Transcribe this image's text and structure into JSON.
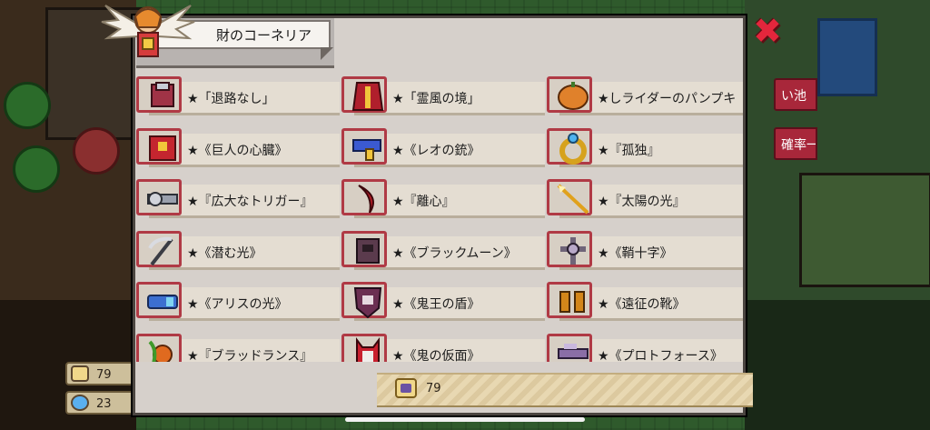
{
  "header": {
    "title": "財のコーネリア"
  },
  "items": [
    {
      "label": "★「退路なし」",
      "icon": "armor-icon",
      "color": "#a03346"
    },
    {
      "label": "★「霊風の境」",
      "icon": "robe-icon",
      "color": "#b01f2c"
    },
    {
      "label": "★しライダーのパンプキ",
      "icon": "pumpkin-icon",
      "color": "#e0812b"
    },
    {
      "label": "★《巨人の心臓》",
      "icon": "heart-armor-icon",
      "color": "#c4252f"
    },
    {
      "label": "★《レオの銃》",
      "icon": "gun-icon",
      "color": "#3b5ad1"
    },
    {
      "label": "★『孤独』",
      "icon": "ring-icon",
      "color": "#d6a21d"
    },
    {
      "label": "★『広大なトリガー』",
      "icon": "cannon-icon",
      "color": "#9aa0ad"
    },
    {
      "label": "★『離心』",
      "icon": "blade-icon",
      "color": "#b51c25"
    },
    {
      "label": "★『太陽の光』",
      "icon": "spear-icon",
      "color": "#e0a11c"
    },
    {
      "label": "★《潜む光》",
      "icon": "scythe-icon",
      "color": "#5c5f6b"
    },
    {
      "label": "★《ブラックムーン》",
      "icon": "dark-block-icon",
      "color": "#5b3b4d"
    },
    {
      "label": "★《鞘十字》",
      "icon": "cross-icon",
      "color": "#6f6478"
    },
    {
      "label": "★《アリスの光》",
      "icon": "blaster-icon",
      "color": "#3c6fd0"
    },
    {
      "label": "★《鬼王の盾》",
      "icon": "shield-icon",
      "color": "#6b2f52"
    },
    {
      "label": "★《遠征の靴》",
      "icon": "boots-icon",
      "color": "#d3861a"
    },
    {
      "label": "★『ブラッドランス』",
      "icon": "vine-lance-icon",
      "color": "#e06a1f"
    },
    {
      "label": "★《鬼の仮面》",
      "icon": "mask-icon",
      "color": "#c81f2e"
    },
    {
      "label": "★《プロトフォース》",
      "icon": "rifle-icon",
      "color": "#8a6ea6"
    }
  ],
  "footer": {
    "value": "79"
  },
  "side_tabs": [
    "い池",
    "確率一覧"
  ],
  "currencies": [
    {
      "value": "79",
      "icon": "coin-icon"
    },
    {
      "value": "23",
      "icon": "gem-icon"
    }
  ]
}
